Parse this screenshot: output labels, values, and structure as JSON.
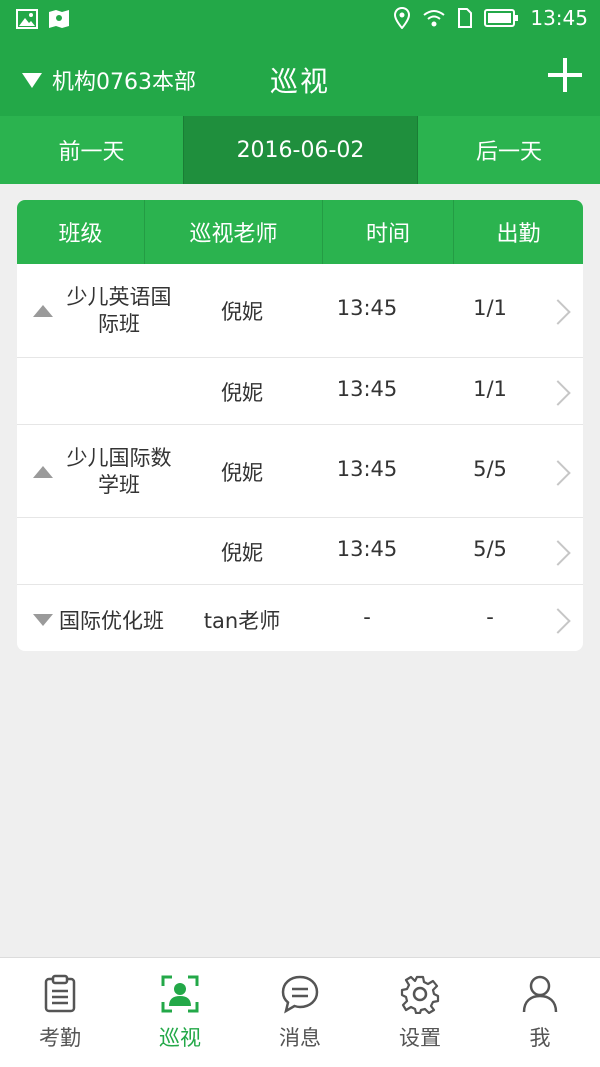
{
  "status_bar": {
    "time": "13:45"
  },
  "header": {
    "org_name": "机构0763本部",
    "title": "巡视"
  },
  "date_bar": {
    "prev_label": "前一天",
    "current_date": "2016-06-02",
    "next_label": "后一天"
  },
  "table": {
    "columns": [
      "班级",
      "巡视老师",
      "时间",
      "出勤"
    ],
    "rows": [
      {
        "class_line1": "少儿英语国",
        "class_line2": "际班",
        "teacher": "倪妮",
        "time": "13:45",
        "attendance": "1/1"
      },
      {
        "teacher": "倪妮",
        "time": "13:45",
        "attendance": "1/1"
      },
      {
        "class_line1": "少儿国际数",
        "class_line2": "学班",
        "teacher": "倪妮",
        "time": "13:45",
        "attendance": "5/5"
      },
      {
        "teacher": "倪妮",
        "time": "13:45",
        "attendance": "5/5"
      },
      {
        "class_name": "国际优化班",
        "teacher": "tan老师",
        "time": "-",
        "attendance": "-"
      }
    ]
  },
  "bottom_nav": {
    "items": [
      {
        "label": "考勤",
        "icon": "clipboard-icon"
      },
      {
        "label": "巡视",
        "icon": "patrol-icon",
        "active": true
      },
      {
        "label": "消息",
        "icon": "message-icon"
      },
      {
        "label": "设置",
        "icon": "gear-icon"
      },
      {
        "label": "我",
        "icon": "user-icon"
      }
    ]
  },
  "colors": {
    "brand_green": "#23a848",
    "active_date_bg": "#1f8f3d"
  }
}
